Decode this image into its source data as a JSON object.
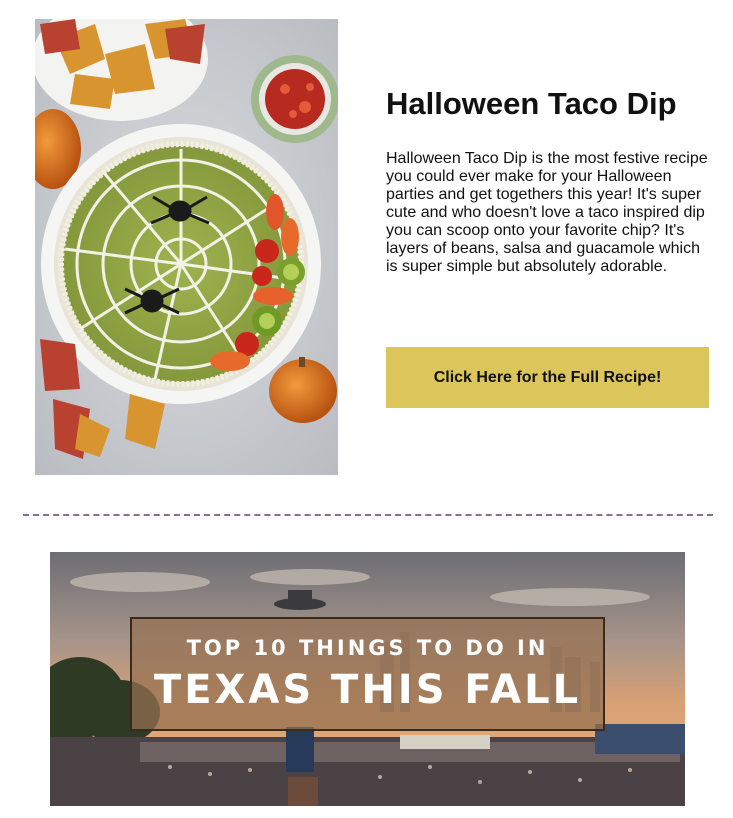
{
  "recipe": {
    "image_alt": "Halloween Taco Dip with spider web sour cream, tortilla chips and salsa",
    "title": "Halloween Taco Dip",
    "description": "Halloween Taco Dip is the most festive recipe you could ever make for your Halloween parties and get togethers this year! It's super cute and who doesn't love a taco inspired dip you can scoop onto your favorite chip? It's layers of beans, salsa and guacamole which is super simple but absolutely adorable.",
    "button_label": "Click Here for the Full Recipe!",
    "button_color": "#dcc55a"
  },
  "divider": {
    "color": "#8a6d93",
    "style": "dashed"
  },
  "banner": {
    "image_alt": "Texas state fair at sunset with Big Tex",
    "line1": "TOP 10 THINGS TO DO IN",
    "line2": "TEXAS THIS FALL"
  }
}
